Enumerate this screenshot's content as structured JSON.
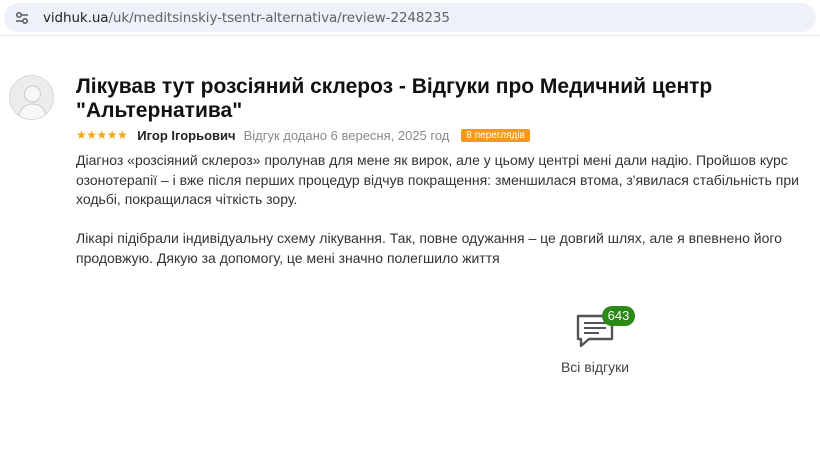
{
  "browser": {
    "url_host": "vidhuk.ua",
    "url_path": "/uk/meditsinskiy-tsentr-alternativa/review-2248235"
  },
  "review": {
    "title": "Лікував тут розсіяний склероз - Відгуки про Медичний центр \"Альтернатива\"",
    "stars": "★★★★★",
    "rating": 5,
    "author": "Игор Ігорьович",
    "date": "Відгук додано 6 вересня, 2025 год",
    "views": "8 переглядів",
    "paragraphs": [
      "Діагноз «розсіяний склероз» пролунав для мене як вирок, але у цьому центрі мені дали надію. Пройшов курс озонотерапії – і вже після перших процедур відчув покращення: зменшилася втома, з'явилася стабільність при ходьбі, покращилася чіткість зору.",
      "Лікарі підібрали індивідуальну схему лікування. Так, повне одужання – це довгий шлях, але я впевнено його продовжую. Дякую за допомогу, це мені значно полегшило життя"
    ]
  },
  "all_reviews": {
    "count": "643",
    "label": "Всі відгуки"
  },
  "colors": {
    "stars": "#f2a511",
    "views_badge": "#f39a1e",
    "count_badge": "#2a8a15"
  },
  "icons": {
    "site_info": "tune-icon",
    "avatar": "user-avatar-icon",
    "all_reviews": "chat-bubble-icon"
  }
}
